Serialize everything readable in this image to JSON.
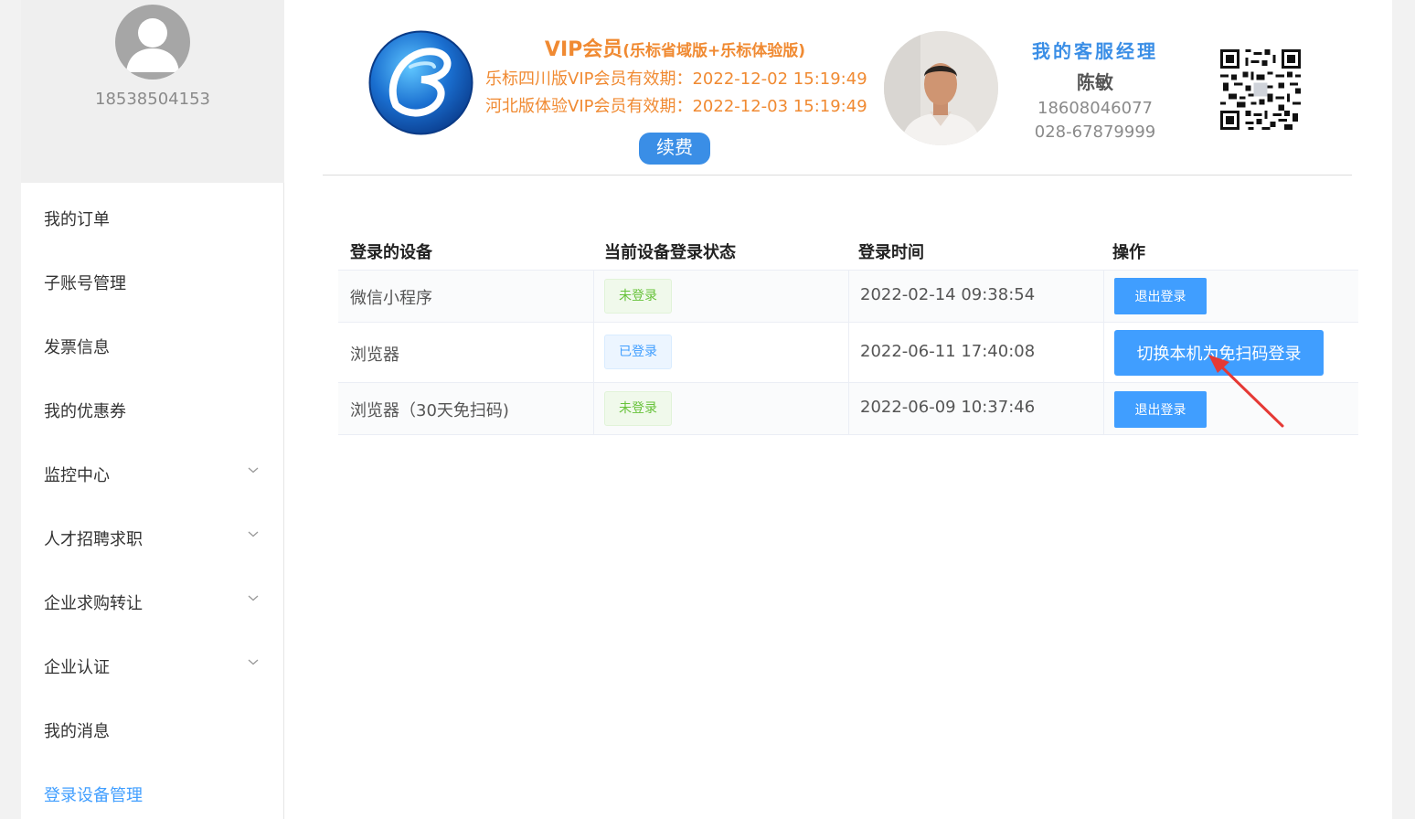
{
  "user": {
    "phone": "18538504153"
  },
  "sidebar": {
    "items": [
      {
        "label": "我的订单",
        "has_submenu": false,
        "active": false
      },
      {
        "label": "子账号管理",
        "has_submenu": false,
        "active": false
      },
      {
        "label": "发票信息",
        "has_submenu": false,
        "active": false
      },
      {
        "label": "我的优惠券",
        "has_submenu": false,
        "active": false
      },
      {
        "label": "监控中心",
        "has_submenu": true,
        "active": false
      },
      {
        "label": "人才招聘求职",
        "has_submenu": true,
        "active": false
      },
      {
        "label": "企业求购转让",
        "has_submenu": true,
        "active": false
      },
      {
        "label": "企业认证",
        "has_submenu": true,
        "active": false
      },
      {
        "label": "我的消息",
        "has_submenu": false,
        "active": false
      },
      {
        "label": "登录设备管理",
        "has_submenu": false,
        "active": true
      }
    ]
  },
  "vip": {
    "title": "VIP会员",
    "title_sub": "(乐标省域版+乐标体验版)",
    "line1": "乐标四川版VIP会员有效期：2022-12-02 15:19:49",
    "line2": "河北版体验VIP会员有效期：2022-12-03 15:19:49",
    "renew_label": "续费"
  },
  "manager": {
    "heading": "我的客服经理",
    "name": "陈敏",
    "mobile": "18608046077",
    "landline": "028-67879999"
  },
  "table": {
    "headers": [
      "登录的设备",
      "当前设备登录状态",
      "登录时间",
      "操作"
    ],
    "rows": [
      {
        "device": "微信小程序",
        "status": "未登录",
        "time": "2022-02-14 09:38:54",
        "action": "退出登录"
      },
      {
        "device": "浏览器",
        "status": "已登录",
        "time": "2022-06-11 17:40:08",
        "action": "切换本机为免扫码登录"
      },
      {
        "device": "浏览器（30天免扫码)",
        "status": "未登录",
        "time": "2022-06-09 10:37:46",
        "action": "退出登录"
      }
    ]
  },
  "colors": {
    "accent": "#409eff",
    "vip_orange": "#f08a32",
    "tag_green": "#67c23a",
    "arrow_red": "#e53935"
  }
}
